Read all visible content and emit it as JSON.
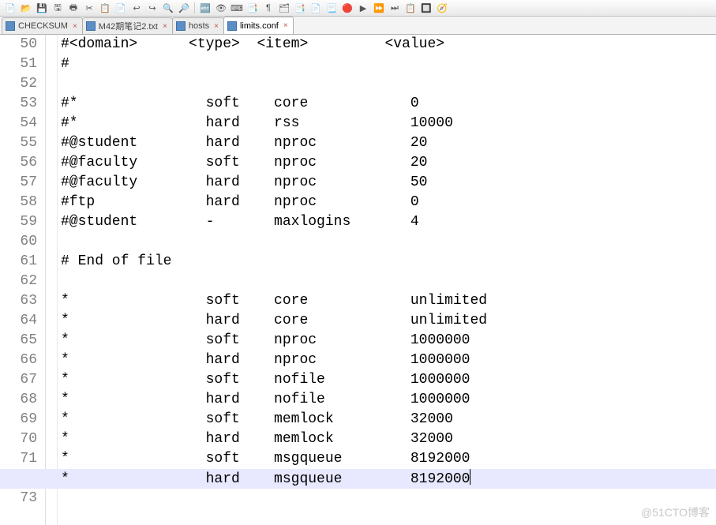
{
  "toolbar_icons": [
    "📄",
    "📂",
    "💾",
    "🖫",
    "🖶",
    "✂",
    "📋",
    "📄",
    "↩",
    "↪",
    "🔍",
    "🔎",
    "||",
    "🔤",
    "👁",
    "⌨",
    "📑",
    "¶",
    "🗂",
    "📑",
    "📄",
    "📃",
    "🔴",
    "▶",
    "⏩",
    "⏭",
    "📋",
    "🔲",
    "🧭"
  ],
  "tabs": [
    {
      "label": "CHECKSUM",
      "active": false
    },
    {
      "label": "M42期笔记2.txt",
      "active": false
    },
    {
      "label": "hosts",
      "active": false
    },
    {
      "label": "limits.conf",
      "active": true
    }
  ],
  "first_line_no": 50,
  "current_line_index": 22,
  "columns_text": "#<domain>      <type>  <item>         <value>",
  "lines": [
    "#<domain>      <type>  <item>         <value>",
    "#",
    "",
    "#*               soft    core            0",
    "#*               hard    rss             10000",
    "#@student        hard    nproc           20",
    "#@faculty        soft    nproc           20",
    "#@faculty        hard    nproc           50",
    "#ftp             hard    nproc           0",
    "#@student        -       maxlogins       4",
    "",
    "# End of file",
    "",
    "*                soft    core            unlimited",
    "*                hard    core            unlimited",
    "*                soft    nproc           1000000",
    "*                hard    nproc           1000000",
    "*                soft    nofile          1000000",
    "*                hard    nofile          1000000",
    "*                soft    memlock         32000",
    "*                hard    memlock         32000",
    "*                soft    msgqueue        8192000",
    "*                hard    msgqueue        8192000",
    ""
  ],
  "watermark": "@51CTO博客"
}
